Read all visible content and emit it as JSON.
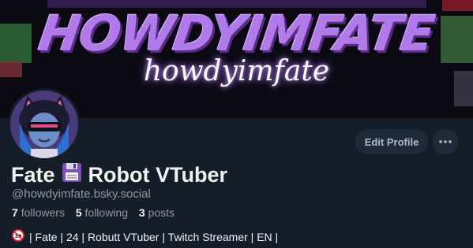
{
  "banner": {
    "title": "HOWDYIMFATE",
    "script": "howdyimfate"
  },
  "profile": {
    "display_name_first": "Fate",
    "display_name_icon": "floppy-disk-icon",
    "display_name_rest": "Robot VTuber",
    "handle": "@howdyimfate.bsky.social",
    "followers_count": "7",
    "followers_label": "followers",
    "following_count": "5",
    "following_label": "following",
    "posts_count": "3",
    "posts_label": "posts",
    "bio_icon": "no-under-18-icon",
    "bio": "| Fate | 24 | Robutt VTuber | Twitch Streamer | EN |"
  },
  "actions": {
    "edit_profile_label": "Edit Profile",
    "more_icon": "ellipsis-icon"
  },
  "colors": {
    "background": "#151d28",
    "banner_purple": "#b07be8",
    "muted_text": "#8b98a5",
    "button_bg": "#1f2a38"
  }
}
